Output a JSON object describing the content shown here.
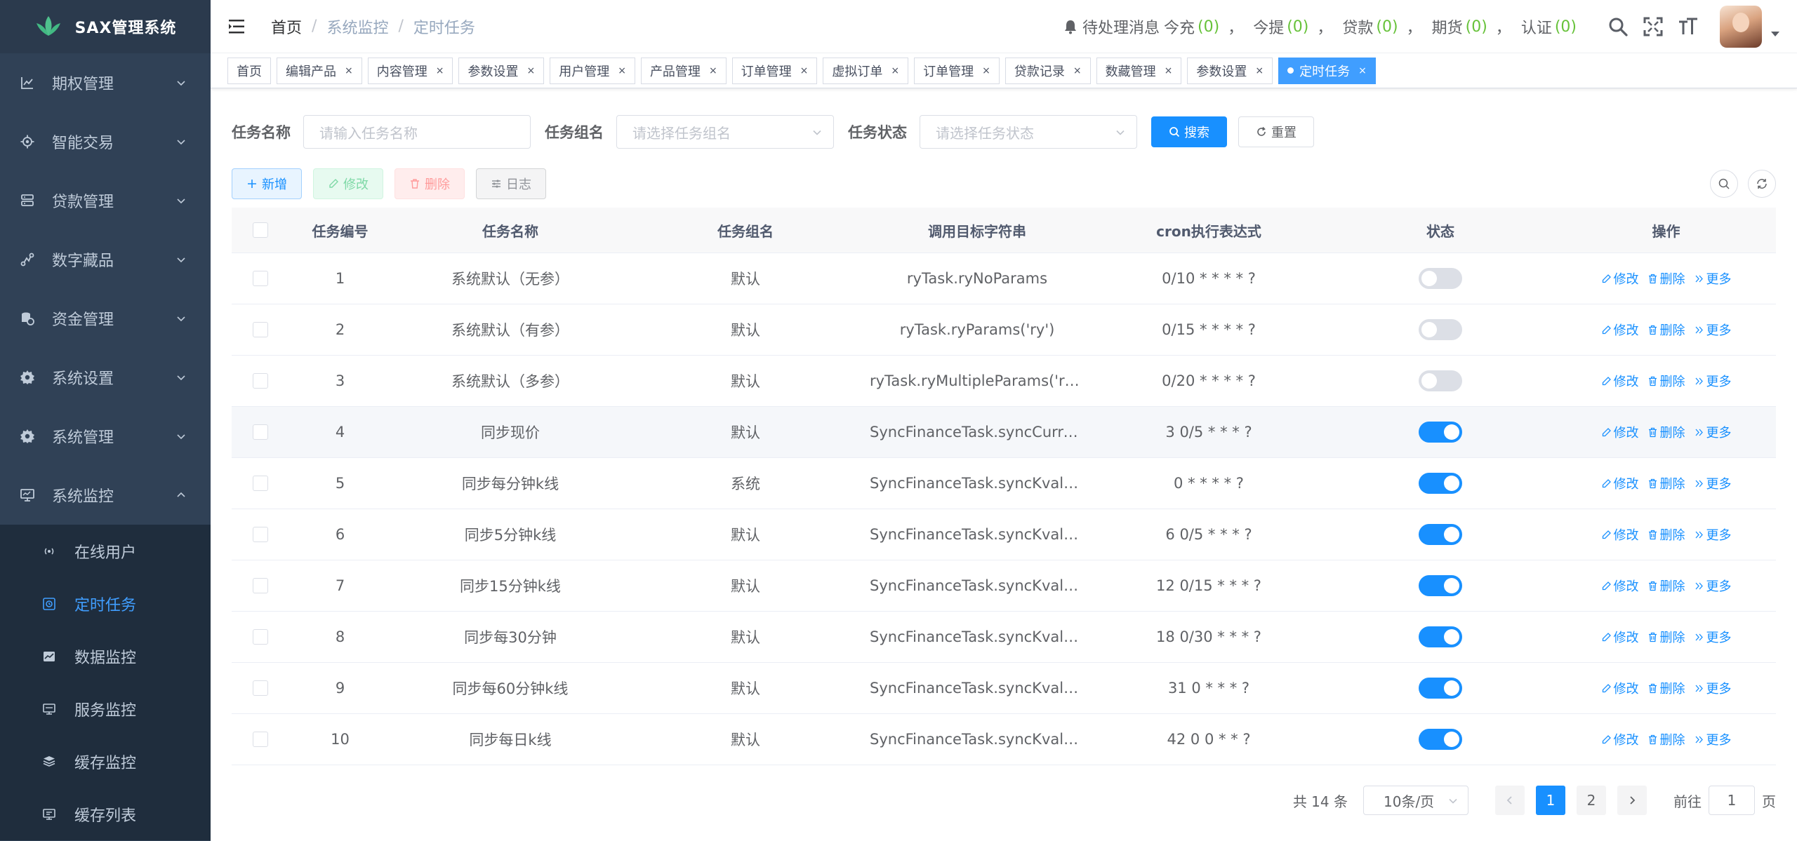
{
  "app": {
    "title": "SAX管理系统"
  },
  "sidebar": {
    "items": [
      {
        "label": "期权管理",
        "icon": "chart-icon"
      },
      {
        "label": "智能交易",
        "icon": "gear-icon"
      },
      {
        "label": "贷款管理",
        "icon": "server-icon"
      },
      {
        "label": "数字藏品",
        "icon": "connection-icon"
      },
      {
        "label": "资金管理",
        "icon": "money-icon"
      },
      {
        "label": "系统设置",
        "icon": "settings-icon"
      },
      {
        "label": "系统管理",
        "icon": "settings-icon"
      },
      {
        "label": "系统监控",
        "icon": "monitor-icon",
        "expanded": true
      }
    ],
    "sub_items": [
      {
        "label": "在线用户",
        "icon": "online-icon"
      },
      {
        "label": "定时任务",
        "icon": "job-icon",
        "active": true
      },
      {
        "label": "数据监控",
        "icon": "druid-icon"
      },
      {
        "label": "服务监控",
        "icon": "server-monitor-icon"
      },
      {
        "label": "缓存监控",
        "icon": "redis-icon"
      },
      {
        "label": "缓存列表",
        "icon": "redis-list-icon"
      }
    ]
  },
  "header": {
    "breadcrumb": [
      "首页",
      "系统监控",
      "定时任务"
    ],
    "notice": {
      "prefix": "待处理消息",
      "items": [
        {
          "label": "今充",
          "count": "(0)"
        },
        {
          "label": "今提",
          "count": "(0)"
        },
        {
          "label": "贷款",
          "count": "(0)"
        },
        {
          "label": "期货",
          "count": "(0)"
        },
        {
          "label": "认证",
          "count": "(0)"
        }
      ],
      "separator": "，"
    }
  },
  "tags": [
    {
      "label": "首页",
      "closable": false
    },
    {
      "label": "编辑产品",
      "closable": true
    },
    {
      "label": "内容管理",
      "closable": true
    },
    {
      "label": "参数设置",
      "closable": true
    },
    {
      "label": "用户管理",
      "closable": true
    },
    {
      "label": "产品管理",
      "closable": true
    },
    {
      "label": "订单管理",
      "closable": true
    },
    {
      "label": "虚拟订单",
      "closable": true
    },
    {
      "label": "订单管理",
      "closable": true
    },
    {
      "label": "贷款记录",
      "closable": true
    },
    {
      "label": "数藏管理",
      "closable": true
    },
    {
      "label": "参数设置",
      "closable": true
    },
    {
      "label": "定时任务",
      "closable": true,
      "active": true
    }
  ],
  "tag_close": "×",
  "search": {
    "job_name_label": "任务名称",
    "job_name_placeholder": "请输入任务名称",
    "job_group_label": "任务组名",
    "job_group_placeholder": "请选择任务组名",
    "status_label": "任务状态",
    "status_placeholder": "请选择任务状态",
    "search_btn": "搜索",
    "reset_btn": "重置"
  },
  "toolbar": {
    "add": "新增",
    "edit": "修改",
    "delete": "删除",
    "log": "日志"
  },
  "table": {
    "columns": [
      "任务编号",
      "任务名称",
      "任务组名",
      "调用目标字符串",
      "cron执行表达式",
      "状态",
      "操作"
    ],
    "rows": [
      {
        "id": "1",
        "name": "系统默认（无参）",
        "group": "默认",
        "target": "ryTask.ryNoParams",
        "cron": "0/10 * * * * ?",
        "status": false
      },
      {
        "id": "2",
        "name": "系统默认（有参）",
        "group": "默认",
        "target": "ryTask.ryParams('ry')",
        "cron": "0/15 * * * * ?",
        "status": false
      },
      {
        "id": "3",
        "name": "系统默认（多参）",
        "group": "默认",
        "target": "ryTask.ryMultipleParams('ry', …",
        "cron": "0/20 * * * * ?",
        "status": false
      },
      {
        "id": "4",
        "name": "同步现价",
        "group": "默认",
        "target": "SyncFinanceTask.syncCurre…",
        "cron": "3 0/5 * * * ?",
        "status": true,
        "highlight": true
      },
      {
        "id": "5",
        "name": "同步每分钟k线",
        "group": "系统",
        "target": "SyncFinanceTask.syncKvalu…",
        "cron": "0 * * * * ?",
        "status": true
      },
      {
        "id": "6",
        "name": "同步5分钟k线",
        "group": "默认",
        "target": "SyncFinanceTask.syncKvalu…",
        "cron": "6 0/5 * * * ?",
        "status": true
      },
      {
        "id": "7",
        "name": "同步15分钟k线",
        "group": "默认",
        "target": "SyncFinanceTask.syncKvalu…",
        "cron": "12 0/15 * * * ?",
        "status": true
      },
      {
        "id": "8",
        "name": "同步每30分钟",
        "group": "默认",
        "target": "SyncFinanceTask.syncKvalu…",
        "cron": "18 0/30 * * * ?",
        "status": true
      },
      {
        "id": "9",
        "name": "同步每60分钟k线",
        "group": "默认",
        "target": "SyncFinanceTask.syncKvalu…",
        "cron": "31 0 * * * ?",
        "status": true
      },
      {
        "id": "10",
        "name": "同步每日k线",
        "group": "默认",
        "target": "SyncFinanceTask.syncKvalu…",
        "cron": "42 0 0 * * ?",
        "status": true
      }
    ],
    "actions": {
      "edit": "修改",
      "delete": "删除",
      "more": "更多"
    }
  },
  "pagination": {
    "total": "共 14 条",
    "page_size": "10条/页",
    "pages": [
      "1",
      "2"
    ],
    "current": "1",
    "goto_label": "前往",
    "goto_value": "1",
    "goto_suffix": "页"
  },
  "colors": {
    "primary": "#1890ff",
    "sidebar_bg": "#304156",
    "submenu_bg": "#1f2d3d",
    "success": "#67c23a"
  }
}
